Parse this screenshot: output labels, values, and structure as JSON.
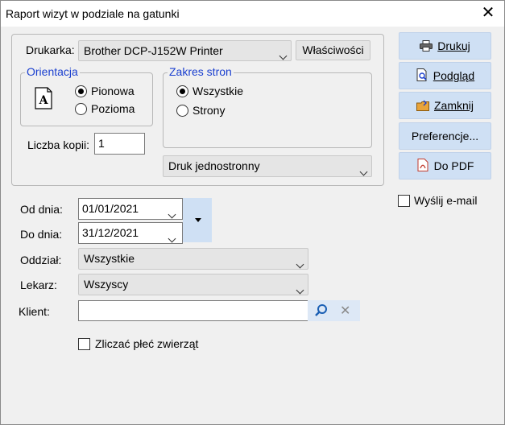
{
  "window": {
    "title": "Raport wizyt w podziale na gatunki"
  },
  "printer": {
    "label": "Drukarka:",
    "selected": "Brother DCP-J152W Printer",
    "properties_button": "Właściwości"
  },
  "orientation": {
    "group_title": "Orientacja",
    "portrait": "Pionowa",
    "landscape": "Pozioma",
    "selected": "Pionowa",
    "icon_letter": "A"
  },
  "page_range": {
    "group_title": "Zakres stron",
    "all": "Wszystkie",
    "pages": "Strony",
    "selected": "Wszystkie"
  },
  "copies": {
    "label": "Liczba kopii:",
    "value": "1"
  },
  "duplex": {
    "selected": "Druk jednostronny"
  },
  "actions": {
    "print": "Drukuj",
    "preview": "Podgląd",
    "close": "Zamknij",
    "preferences": "Preferencje...",
    "to_pdf": "Do PDF"
  },
  "email": {
    "label": "Wyślij e-mail",
    "checked": false
  },
  "filters": {
    "date_from_label": "Od dnia:",
    "date_from": "01/01/2021",
    "date_to_label": "Do dnia:",
    "date_to": "31/12/2021",
    "branch_label": "Oddział:",
    "branch": "Wszystkie",
    "doctor_label": "Lekarz:",
    "doctor": "Wszyscy",
    "client_label": "Klient:",
    "client_value": ""
  },
  "count_sex": {
    "label": "Zliczać płeć zwierząt",
    "checked": false
  },
  "colors": {
    "group_title": "#1a3fcf",
    "action_button": "#cfe0f4"
  }
}
